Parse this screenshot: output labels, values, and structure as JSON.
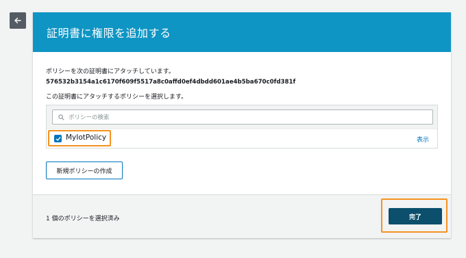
{
  "header": {
    "title": "証明書に権限を追加する"
  },
  "body": {
    "desc1": "ポリシーを次の証明書にアタッチしています。",
    "cert_id": "576532b3154a1c6170f609f5517a8c0affd0ef4dbdd601ae4b5ba670c0fd381f",
    "desc2": "この証明書にアタッチするポリシーを選択します。"
  },
  "search": {
    "placeholder": "ポリシーの検索"
  },
  "policies": [
    {
      "name": "MyIotPolicy",
      "checked": true,
      "link": "表示"
    }
  ],
  "create_button": "新規ポリシーの作成",
  "footer": {
    "selected_count": "1 個のポリシーを選択済み",
    "done_button": "完了"
  },
  "colors": {
    "header_bg": "#0e95c4",
    "primary_button": "#0b4f6c",
    "highlight": "#f5921f",
    "link": "#0073bb"
  }
}
